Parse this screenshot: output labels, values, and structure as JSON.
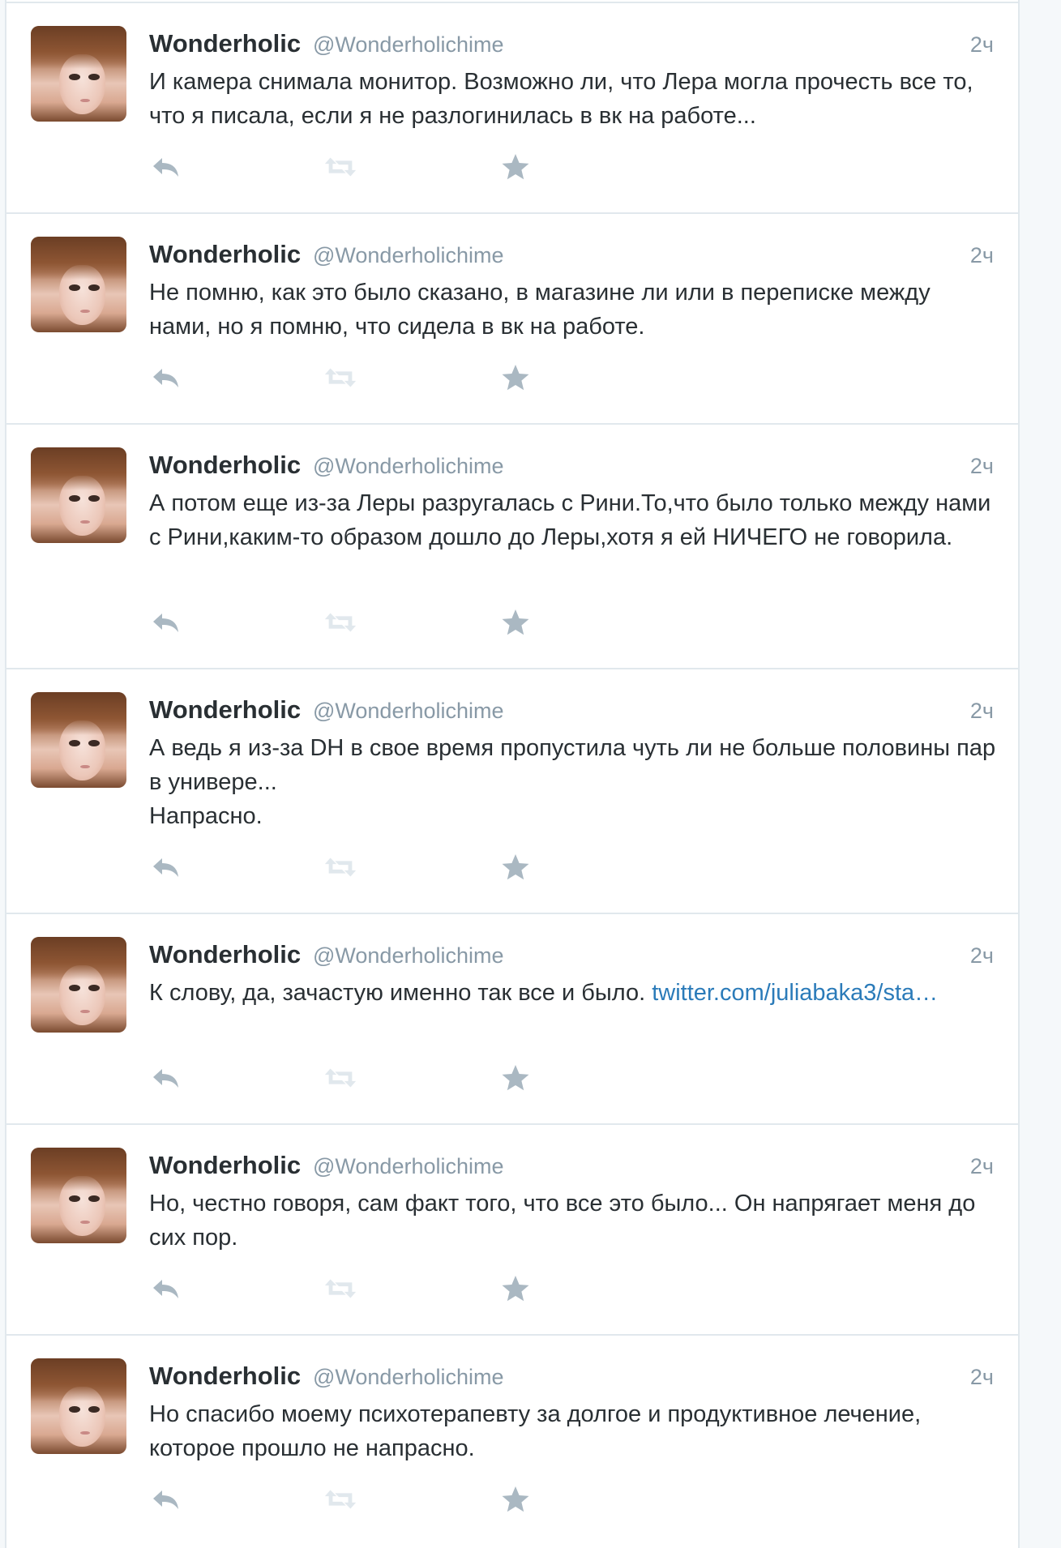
{
  "tweets": [
    {
      "name": "Wonderholic",
      "handle": "@Wonderholichime",
      "time": "2ч",
      "text": "И камера снимала монитор. Возможно ли, что Лера могла прочесть все то, что я писала, если я не разлогинилась в вк на работе...",
      "link": ""
    },
    {
      "name": "Wonderholic",
      "handle": "@Wonderholichime",
      "time": "2ч",
      "text": "Не помню, как это было сказано, в магазине ли или в переписке между нами, но я помню, что сидела в вк на работе.",
      "link": ""
    },
    {
      "name": "Wonderholic",
      "handle": "@Wonderholichime",
      "time": "2ч",
      "text": "А потом еще из-за Леры разругалась с Рини.То,что было только между нами с Рини,каким-то образом дошло до Леры,хотя я ей НИЧЕГО не говорила.",
      "link": ""
    },
    {
      "name": "Wonderholic",
      "handle": "@Wonderholichime",
      "time": "2ч",
      "text": "А ведь я из-за DH в свое время пропустила чуть ли не больше половины пар в универе...\nНапрасно.",
      "link": ""
    },
    {
      "name": "Wonderholic",
      "handle": "@Wonderholichime",
      "time": "2ч",
      "text": "К слову, да, зачастую именно так все и было. ",
      "link": "twitter.com/juliabaka3/sta…"
    },
    {
      "name": "Wonderholic",
      "handle": "@Wonderholichime",
      "time": "2ч",
      "text": "Но, честно говоря, сам факт того, что все это было... Он напрягает меня до сих пор.",
      "link": ""
    },
    {
      "name": "Wonderholic",
      "handle": "@Wonderholichime",
      "time": "2ч",
      "text": "Но спасибо моему психотерапевту за долгое и продуктивное лечение, которое прошло не напрасно.",
      "link": ""
    }
  ],
  "icons": {
    "reply": "reply-icon",
    "retweet": "retweet-icon",
    "favorite": "favorite-star-icon"
  },
  "colors": {
    "name": "#292f33",
    "meta": "#8899a6",
    "link": "#2b7bb9",
    "action_icon": "#aab8c2",
    "border": "#e1e8ed"
  }
}
